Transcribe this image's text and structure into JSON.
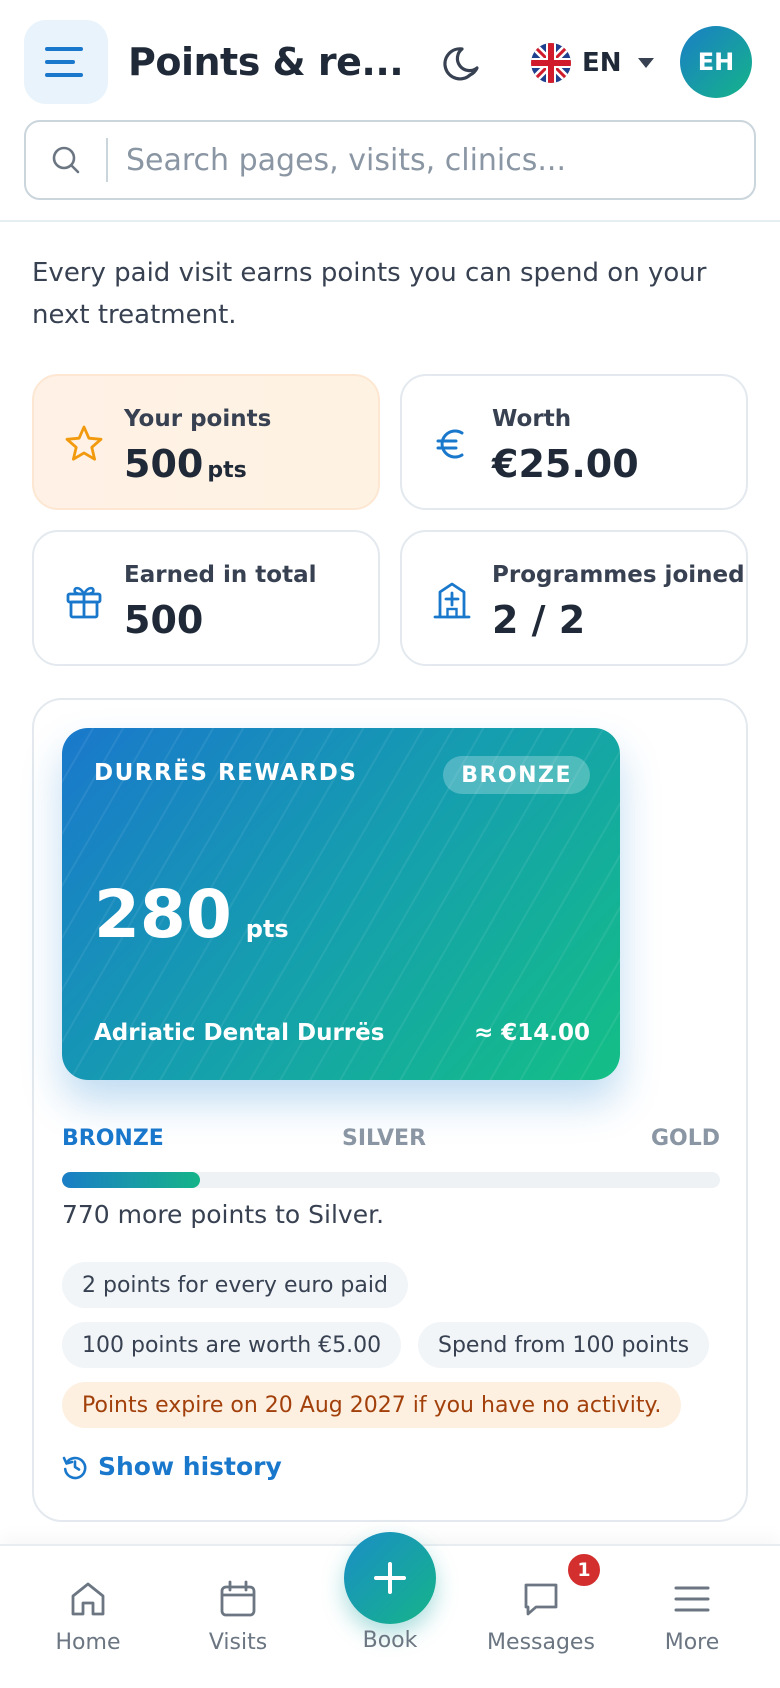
{
  "header": {
    "title": "Points & re...",
    "language": "EN",
    "avatar_initials": "EH"
  },
  "search": {
    "placeholder": "Search pages, visits, clinics..."
  },
  "intro": "Every paid visit earns points you can spend on your next treatment.",
  "stats": {
    "points": {
      "label": "Your points",
      "value": "500",
      "unit": "pts",
      "icon": "star-icon"
    },
    "worth": {
      "label": "Worth",
      "value": "€25.00",
      "icon": "euro-icon"
    },
    "earned": {
      "label": "Earned in total",
      "value": "500",
      "icon": "gift-icon"
    },
    "programmes": {
      "label": "Programmes joined",
      "value": "2 / 2",
      "icon": "clinic-icon"
    }
  },
  "program": {
    "name": "DURRËS REWARDS",
    "tier": "BRONZE",
    "points": "280",
    "points_unit": "pts",
    "clinic": "Adriatic Dental Durrës",
    "worth": "≈ €14.00",
    "tiers": [
      "BRONZE",
      "SILVER",
      "GOLD"
    ],
    "progress_fraction": 0.21,
    "progress_note": "770 more points to Silver.",
    "chips": {
      "earn_rate": "2 points for every euro paid",
      "value_rate": "100 points are worth €5.00",
      "min_spend": "Spend from 100 points",
      "expiry": "Points expire on 20 Aug 2027 if you have no activity."
    },
    "history_label": "Show history"
  },
  "nav": {
    "home": "Home",
    "visits": "Visits",
    "book": "Book",
    "messages": "Messages",
    "messages_badge": "1",
    "more": "More"
  },
  "colors": {
    "brand_blue": "#1a78cc",
    "brand_green": "#15b489",
    "warning_text": "#a2400b",
    "badge_red": "#d32f2f"
  }
}
